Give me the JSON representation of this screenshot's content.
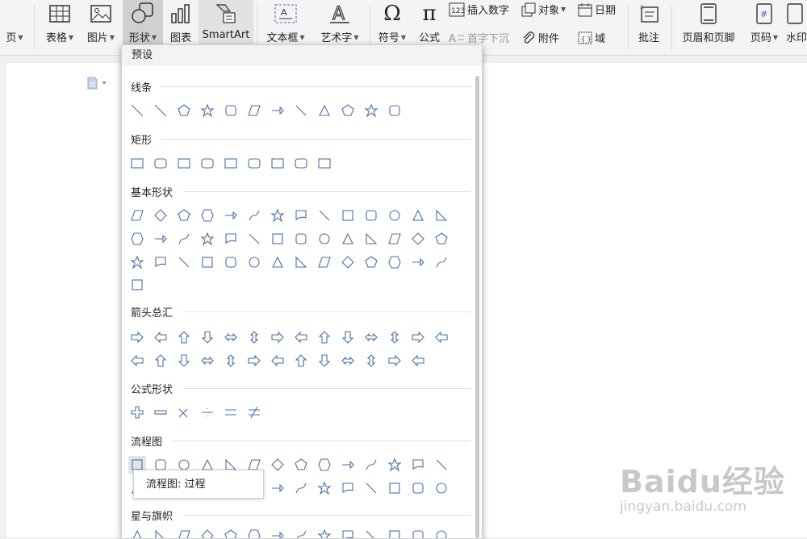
{
  "ribbon": {
    "items": [
      {
        "label": "页",
        "name": "page-button"
      },
      {
        "label": "表格",
        "name": "table-button"
      },
      {
        "label": "图片",
        "name": "picture-button"
      },
      {
        "label": "形状",
        "name": "shapes-button"
      },
      {
        "label": "图表",
        "name": "chart-button"
      },
      {
        "label": "SmartArt",
        "name": "smartart-button"
      },
      {
        "label": "文本框",
        "name": "textbox-button"
      },
      {
        "label": "艺术字",
        "name": "wordart-button"
      },
      {
        "label": "符号",
        "name": "symbol-button"
      },
      {
        "label": "公式",
        "name": "equation-button"
      },
      {
        "label": "批注",
        "name": "comment-button"
      },
      {
        "label": "页眉和页脚",
        "name": "header-footer-button"
      },
      {
        "label": "页码",
        "name": "page-number-button"
      },
      {
        "label": "水印",
        "name": "watermark-button"
      }
    ],
    "small": {
      "insert_number": "插入数字",
      "drop_cap": "首字下沉",
      "object": "对象",
      "attachment": "附件",
      "date": "日期",
      "field": "域"
    }
  },
  "panel": {
    "header": "预设",
    "sections": {
      "lines": "线条",
      "rect": "矩形",
      "basic": "基本形状",
      "arrows": "箭头总汇",
      "formula": "公式形状",
      "flowchart": "流程图",
      "stars": "星与旗帜"
    },
    "tooltip": "流程图: 过程"
  },
  "watermark": {
    "brand": "Baidu经验",
    "url": "jingyan.baidu.com"
  },
  "colors": {
    "shape_stroke": "#4a6fa5",
    "accent": "#4a6fa5"
  }
}
